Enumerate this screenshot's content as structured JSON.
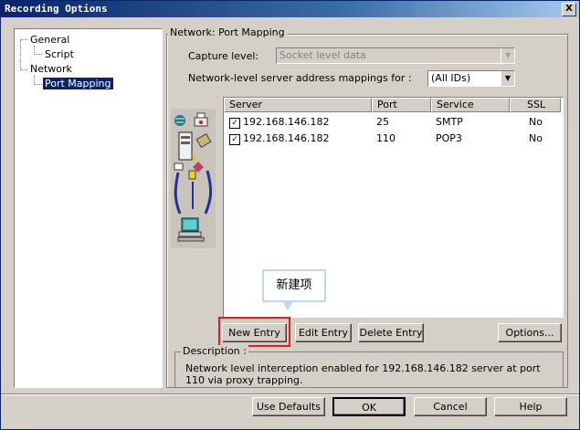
{
  "window": {
    "title": "Recording Options",
    "close": "X"
  },
  "tree": {
    "items": [
      {
        "label": "General"
      },
      {
        "label": "Script"
      },
      {
        "label": "Network"
      },
      {
        "label": "Port Mapping"
      }
    ]
  },
  "group": {
    "label": "Network: Port Mapping"
  },
  "capture": {
    "label": "Capture level:",
    "value": "Socket level data"
  },
  "mapping": {
    "label": "Network-level server address mappings for :",
    "value": "(All IDs)"
  },
  "table": {
    "headers": [
      "Server",
      "Port",
      "Service",
      "SSL"
    ],
    "rows": [
      {
        "checked": "✓",
        "server": "192.168.146.182",
        "port": "25",
        "service": "SMTP",
        "ssl": "No"
      },
      {
        "checked": "✓",
        "server": "192.168.146.182",
        "port": "110",
        "service": "POP3",
        "ssl": "No"
      }
    ]
  },
  "buttons": {
    "new_entry": "New Entry",
    "edit_entry": "Edit Entry",
    "delete_entry": "Delete Entry",
    "options": "Options..."
  },
  "tooltip": {
    "text": "新建项"
  },
  "description": {
    "label": "Description :",
    "text": "Network level interception enabled for 192.168.146.182 server at port 110 via proxy trapping."
  },
  "footer": {
    "use_defaults": "Use Defaults",
    "ok": "OK",
    "cancel": "Cancel",
    "help": "Help"
  },
  "colors": {
    "title_bar": "#0a246a",
    "highlight": "#e02020",
    "selection": "#0a246a"
  },
  "icons": [
    "globe-icon",
    "server-icon",
    "printer-icon",
    "network-icon",
    "computer-icon"
  ]
}
